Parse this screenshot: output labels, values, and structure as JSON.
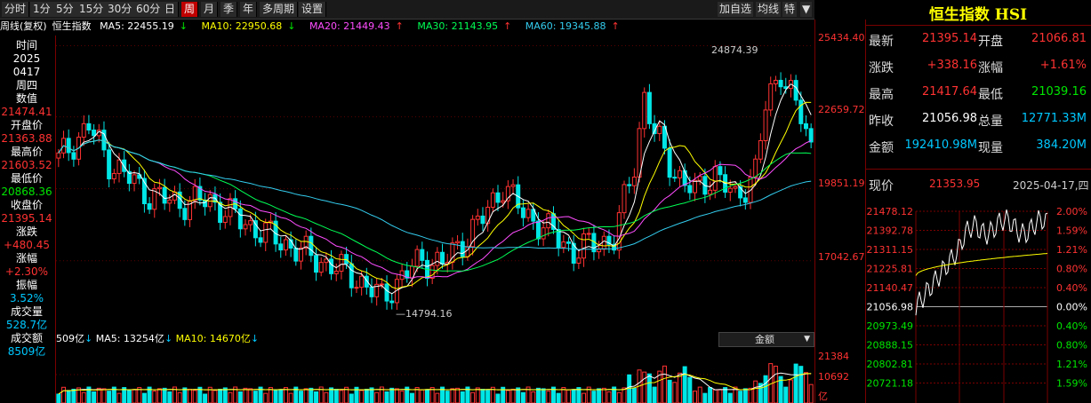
{
  "toolbar": {
    "periods": [
      "分时",
      "1分",
      "5分",
      "15分",
      "30分",
      "60分",
      "日",
      "周",
      "月",
      "季",
      "年",
      "多周期",
      "设置"
    ],
    "active_period": "周",
    "right_items": [
      "加自选",
      "均线",
      "特"
    ],
    "close_glyph": "▼"
  },
  "ma_header": {
    "title": "周线(复权)",
    "name": "恒生指数",
    "ma5": "MA5: 22455.19",
    "ma10": "MA10: 22950.68",
    "ma20": "MA20: 21449.43",
    "ma30": "MA30: 21143.95",
    "ma60": "MA60: 19345.88",
    "arrow_down": "↓",
    "arrow_up": "↑"
  },
  "left_panel": {
    "time_label": "时间",
    "year": "2025",
    "date": "0417",
    "weekday": "周四",
    "value_label": "数值",
    "value": "21474.41",
    "open_label": "开盘价",
    "open": "21363.88",
    "high_label": "最高价",
    "high": "21603.52",
    "low_label": "最低价",
    "low": "20868.36",
    "close_label": "收盘价",
    "close": "21395.14",
    "change_label": "涨跌",
    "change": "+480.45",
    "pct_label": "涨幅",
    "pct": "+2.30%",
    "amp_label": "振幅",
    "amp": "3.52%",
    "vol_label": "成交量",
    "vol": "528.7亿",
    "amount_label": "成交额",
    "amount": "8509亿"
  },
  "chart": {
    "high_annotation": "24874.39",
    "low_annotation": "14794.16",
    "price_labels": [
      "25434.40",
      "22659.72",
      "19851.19",
      "17042.67"
    ]
  },
  "volume": {
    "prefix": "509亿",
    "ma5": "MA5: 13254亿",
    "ma10": "MA10: 14670亿",
    "arrow": "↓",
    "select_label": "金额",
    "select_glyph": "▼",
    "axis_labels": [
      "21384",
      "10692",
      "亿"
    ]
  },
  "quote": {
    "title": "恒生指数 HSI",
    "rows": [
      {
        "l1": "最新",
        "v1": "21395.14",
        "l2": "开盘",
        "v2": "21066.81",
        "c1": "#ff3232",
        "c2": "#ff3232"
      },
      {
        "l1": "涨跌",
        "v1": "+338.16",
        "l2": "涨幅",
        "v2": "+1.61%",
        "c1": "#ff3232",
        "c2": "#ff3232"
      },
      {
        "l1": "最高",
        "v1": "21417.64",
        "l2": "最低",
        "v2": "21039.16",
        "c1": "#ff3232",
        "c2": "#00e600"
      },
      {
        "l1": "昨收",
        "v1": "21056.98",
        "l2": "总量",
        "v2": "12771.33M",
        "c1": "#ffffff",
        "c2": "#00c8ff"
      },
      {
        "l1": "金额",
        "v1": "192410.98M",
        "l2": "现量",
        "v2": "384.20M",
        "c1": "#00c8ff",
        "c2": "#00c8ff"
      }
    ],
    "now_label": "现价",
    "now_value": "21353.95",
    "now_date": "2025-04-17,四"
  },
  "intraday": {
    "price_labels": [
      "21478.12",
      "21392.78",
      "21311.15",
      "21225.81",
      "21140.47",
      "21056.98",
      "20973.49",
      "20888.15",
      "20802.81",
      "20721.18"
    ],
    "pct_labels": [
      "2.00%",
      "1.59%",
      "1.21%",
      "0.80%",
      "0.40%",
      "0.00%",
      "0.40%",
      "0.80%",
      "1.21%",
      "1.59%"
    ]
  },
  "colors": {
    "up": "#ff3232",
    "down": "#00e6e6",
    "ma5": "#ffffff",
    "ma10": "#ffff00",
    "ma20": "#ff4dff",
    "ma30": "#00ff55",
    "ma60": "#33ccee"
  }
}
